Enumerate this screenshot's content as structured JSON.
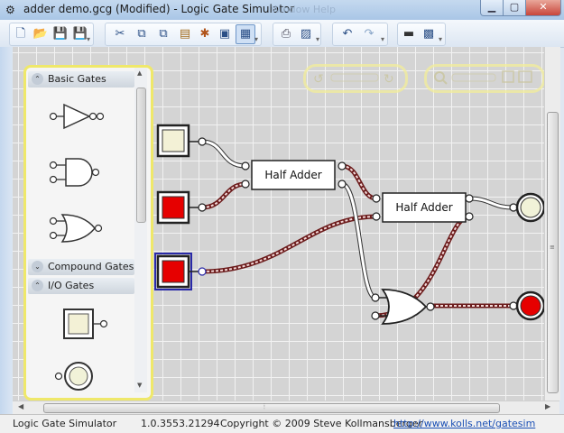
{
  "window": {
    "title": "adder demo.gcg (Modified)  - Logic Gate Simulator",
    "ghost_menu": "Window   Help"
  },
  "toolbar": {
    "groups": [
      [
        "new-icon",
        "open-icon",
        "save-icon",
        "save-as-icon"
      ],
      [
        "cut-icon",
        "copy-icon",
        "paste-icon",
        "paste-special-icon",
        "bug-icon",
        "zoom-fit-icon",
        "screenshot-icon"
      ],
      [
        "print-icon",
        "print-preview-icon"
      ],
      [
        "undo-icon",
        "redo-icon"
      ],
      [
        "chip-icon",
        "ic-icon"
      ]
    ]
  },
  "palette": {
    "sections": [
      {
        "label": "Basic Gates",
        "state": "expanded"
      },
      {
        "label": "Compound Gates",
        "state": "collapsed"
      },
      {
        "label": "I/O Gates",
        "state": "expanded"
      }
    ],
    "basic_gates": [
      "not-gate-icon",
      "and-gate-icon",
      "or-gate-icon"
    ],
    "io_gates": [
      "user-input-icon",
      "user-output-icon"
    ]
  },
  "circuit": {
    "inputs": [
      {
        "id": "in1",
        "state": "off",
        "color": "#f3f1d6"
      },
      {
        "id": "in2",
        "state": "on",
        "color": "#e60000"
      },
      {
        "id": "in3",
        "state": "on",
        "color": "#e60000",
        "selected": true
      }
    ],
    "half_adder_1": "Half Adder",
    "half_adder_2": "Half Adder",
    "outputs": [
      {
        "id": "sum",
        "state": "off",
        "color": "#f1f2d8"
      },
      {
        "id": "carry",
        "state": "on",
        "color": "#e60000"
      }
    ]
  },
  "colors": {
    "wire_on": "#b32b2b",
    "wire_off": "#ffffff",
    "palette_border": "#efe86a",
    "grid_bg": "#d4d4d4"
  },
  "statusbar": {
    "app": "Logic Gate Simulator",
    "version": "1.0.3553.21294",
    "copyright": "Copyright © 2009 Steve Kollmansberger",
    "url": "http://www.kolls.net/gatesim"
  }
}
